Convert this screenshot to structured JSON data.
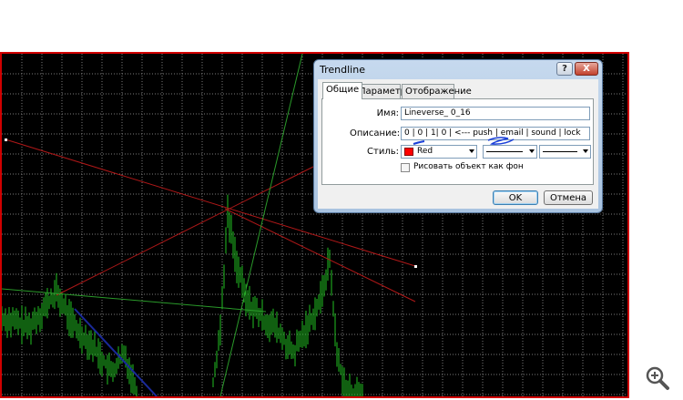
{
  "dialog": {
    "title": "Trendline",
    "help_glyph": "?",
    "close_glyph": "X",
    "tabs": [
      {
        "label": "Общие"
      },
      {
        "label": "Параметры"
      },
      {
        "label": "Отображение"
      }
    ],
    "name_label": "Имя:",
    "name_value": "Lineverse_  0_16",
    "description_label": "Описание:",
    "description_value": "0 | 0 | 1| 0 | <--- push | email | sound | lock",
    "style_label": "Стиль:",
    "color_value": "Red",
    "color_hex": "#ff0000",
    "background_checkbox_label": "Рисовать объект как фон",
    "ok_label": "OK",
    "cancel_label": "Отмена"
  },
  "chart": {
    "background": "#000000",
    "grid_color": "#7a7a7a",
    "price_color": "#22c022",
    "trend_line_color": "#b01818",
    "frame_color": "#d00000"
  },
  "icons": {
    "zoom": "zoom-in-icon"
  }
}
